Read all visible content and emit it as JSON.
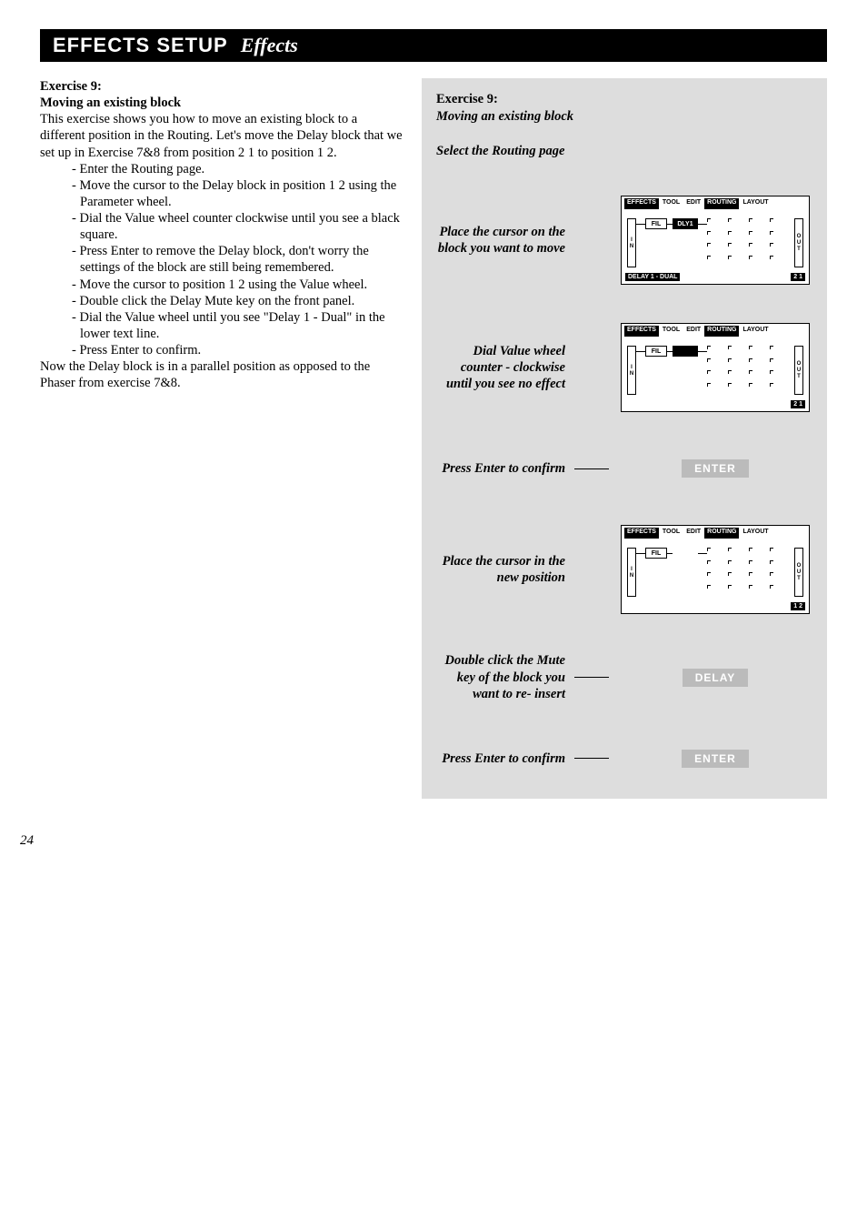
{
  "header": {
    "title": "EFFECTS SETUP",
    "subtitle": "Effects"
  },
  "left": {
    "exercise_title": "Exercise 9:",
    "exercise_subtitle": "Moving an existing block",
    "intro": "This exercise shows you how to move an existing block to a different position in the Routing. Let's move the Delay block that we set up in Exercise 7&8 from position 2 1 to position 1 2.",
    "bullets": [
      "Enter the Routing page.",
      "Move the cursor to the Delay block in position 1 2 using the Parameter wheel.",
      "Dial the Value wheel counter clockwise until you see a black square.",
      "Press Enter to remove the Delay block, don't worry the settings of the block are still being remembered.",
      "Move the cursor to position 1 2 using the Value wheel.",
      "Double click the Delay Mute key on the front panel.",
      "Dial the Value wheel until you see \"Delay 1 - Dual\" in the lower text line.",
      "Press Enter to confirm."
    ],
    "outro": "Now the Delay block is in a parallel position as opposed to the Phaser from exercise 7&8."
  },
  "right": {
    "title": "Exercise 9:",
    "subtitle_i": "Moving an existing block",
    "select_line": "Select the Routing page",
    "steps": [
      {
        "label": "Place the cursor on the block you want to move",
        "kind": "lcd",
        "lcd": {
          "foot_left": "DELAY 1 - DUAL",
          "foot_right": "2 1",
          "dly": true,
          "chip2": "dly"
        }
      },
      {
        "label": "Dial Value wheel counter - clockwise until you see no effect",
        "kind": "lcd",
        "lcd": {
          "foot_left": "",
          "foot_right": "2 1",
          "dly": false,
          "chip2": "blk"
        }
      },
      {
        "label": "Press Enter to confirm",
        "kind": "btn",
        "btn": "ENTER"
      },
      {
        "label": "Place the cursor in the new position",
        "kind": "lcd",
        "lcd": {
          "foot_left": "",
          "foot_right": "1 2",
          "dly": false,
          "chip2": "none"
        }
      },
      {
        "label": "Double click the Mute key of the block you want to re- insert",
        "kind": "btn",
        "btn": "DELAY"
      },
      {
        "label": "Press Enter to confirm",
        "kind": "btn",
        "btn": "ENTER"
      }
    ]
  },
  "lcd": {
    "tabs": [
      "EFFECTS",
      "TOOL",
      "EDIT",
      "ROUTING",
      "LAYOUT"
    ],
    "fil": "FIL",
    "dly": "DLY1",
    "in": [
      "I",
      "N"
    ],
    "out": [
      "O",
      "U",
      "T"
    ]
  },
  "page_number": "24"
}
